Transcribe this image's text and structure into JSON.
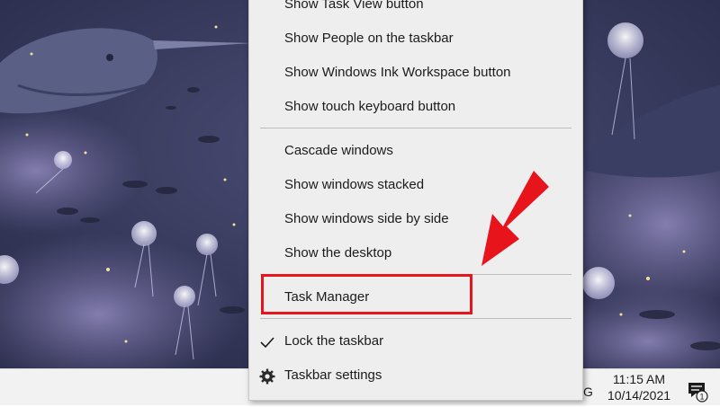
{
  "context_menu": {
    "items_group_1": [
      {
        "label": "Show Task View button"
      },
      {
        "label": "Show People on the taskbar"
      },
      {
        "label": "Show Windows Ink Workspace button"
      },
      {
        "label": "Show touch keyboard button"
      }
    ],
    "items_group_2": [
      {
        "label": "Cascade windows"
      },
      {
        "label": "Show windows stacked"
      },
      {
        "label": "Show windows side by side"
      },
      {
        "label": "Show the desktop"
      }
    ],
    "task_manager": {
      "label": "Task Manager"
    },
    "lock_taskbar": {
      "label": "Lock the taskbar",
      "checked": true,
      "icon": "checkmark-icon"
    },
    "taskbar_settings": {
      "label": "Taskbar settings",
      "icon": "gear-icon"
    }
  },
  "taskbar": {
    "tray_partial": "G",
    "time": "11:15 AM",
    "date": "10/14/2021",
    "notification_count": "1"
  },
  "annotation": {
    "highlight_color": "#e8141c",
    "arrow_color": "#e8141c"
  },
  "colors": {
    "wallpaper_dark": "#2e3253",
    "menu_bg": "#eeeeee",
    "taskbar_bg": "#f2f2f2"
  }
}
